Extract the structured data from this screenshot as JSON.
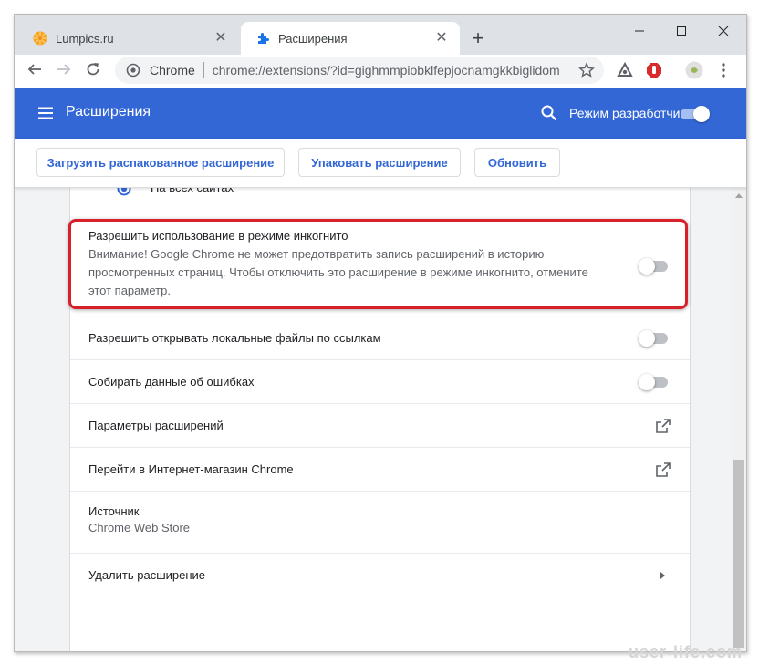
{
  "tabs": [
    {
      "title": "Lumpics.ru",
      "icon": "lumpics-favicon-icon"
    },
    {
      "title": "Расширения",
      "icon": "puzzle-piece-icon"
    }
  ],
  "toolbar": {
    "omnibox_chip": "Chrome",
    "url": "chrome://extensions/?id=gighmmpiobklfepjocnamgkkbiglidom"
  },
  "header": {
    "title": "Расширения",
    "dev_mode_label": "Режим разработчика",
    "dev_mode_on": true
  },
  "actions": {
    "load_unpacked": "Загрузить распакованное расширение",
    "pack": "Упаковать расширение",
    "update": "Обновить"
  },
  "details": {
    "cut_off_option": "На всех сайтах",
    "incognito": {
      "label": "Разрешить использование в режиме инкогнито",
      "warning_lines": [
        "Внимание! Google Chrome не может предотвратить запись расширений в историю",
        "просмотренных страниц. Чтобы отключить это расширение в режиме инкогнито, отмените",
        "этот параметр."
      ],
      "enabled": false
    },
    "file_urls": {
      "label": "Разрешить открывать локальные файлы по ссылкам",
      "enabled": false
    },
    "errors": {
      "label": "Собирать данные об ошибках",
      "enabled": false
    },
    "options_link": "Параметры расширений",
    "store_link": "Перейти в Интернет-магазин Chrome",
    "source": {
      "label": "Источник",
      "value": "Chrome Web Store"
    },
    "remove": "Удалить расширение"
  },
  "watermark": "user-life.com",
  "colors": {
    "header_blue": "#3367d6",
    "highlight_red": "#d8202a",
    "tabstrip_gray": "#dee1e6"
  }
}
